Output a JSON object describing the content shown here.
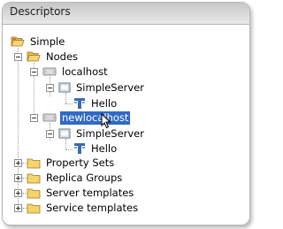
{
  "panel": {
    "title": "Descriptors"
  },
  "tree": {
    "root": "Simple",
    "nodes": "Nodes",
    "node1": "localhost",
    "server1": "SimpleServer",
    "svc1": "Hello",
    "node2": "newlocalhost",
    "server2": "SimpleServer",
    "svc2": "Hello",
    "property_sets": "Property Sets",
    "replica_groups": "Replica Groups",
    "server_templates": "Server templates",
    "service_templates": "Service templates"
  },
  "colors": {
    "selection": "#316ac5",
    "folder": "#f3d56b",
    "service_icon": "#3b6bb0"
  }
}
